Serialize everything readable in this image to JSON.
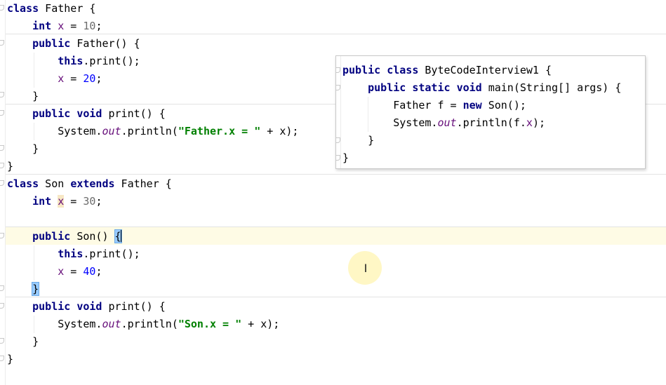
{
  "editor": {
    "father_class": {
      "decl": [
        "class",
        " Father {"
      ],
      "field": [
        "int",
        " ",
        "x",
        " = ",
        "10",
        ";"
      ],
      "ctor": [
        "public",
        " Father() {"
      ],
      "ctor_call": [
        "this",
        ".print();"
      ],
      "ctor_assign": [
        "x",
        " = ",
        "20",
        ";"
      ],
      "ctor_close": "}",
      "method": [
        "public",
        " ",
        "void",
        " print() {"
      ],
      "method_body": [
        "System.",
        "out",
        ".println(",
        "\"Father.x = \"",
        " + x);"
      ],
      "method_close": "}",
      "close": "}"
    },
    "son_class": {
      "decl": [
        "class",
        " Son ",
        "extends",
        " Father {"
      ],
      "field": [
        "int",
        " ",
        "x",
        " = ",
        "30",
        ";"
      ],
      "ctor": [
        "public",
        " Son() ",
        "{"
      ],
      "ctor_call": [
        "this",
        ".print();"
      ],
      "ctor_assign": [
        "x",
        " = ",
        "40",
        ";"
      ],
      "ctor_close": "}",
      "method": [
        "public",
        " ",
        "void",
        " print() {"
      ],
      "method_body": [
        "System.",
        "out",
        ".println(",
        "\"Son.x = \"",
        " + x);"
      ],
      "method_close": "}",
      "close": "}"
    }
  },
  "popup": {
    "decl": [
      "public",
      " ",
      "class",
      " ByteCodeInterview1 {"
    ],
    "main": [
      "public",
      " ",
      "static",
      " ",
      "void",
      " main(String[] args) {"
    ],
    "stmt1": [
      "Father f = ",
      "new",
      " Son();"
    ],
    "stmt2": [
      "System.",
      "out",
      ".println(f.",
      "x",
      ");"
    ],
    "inner_close": "}",
    "outer_close": "}"
  },
  "cursor": {
    "glyph": "I"
  },
  "colors": {
    "keyword": "#000080",
    "field": "#660e7a",
    "string": "#008000",
    "number_default": "#6c6c6c",
    "number_literal": "#0000ff",
    "caret_row": "#fefbe5",
    "brace_match": "#99ccff"
  }
}
